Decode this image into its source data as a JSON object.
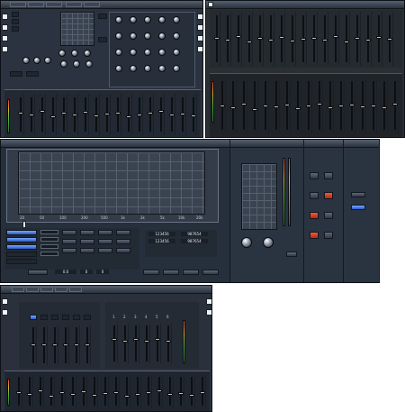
{
  "top_left": {
    "tabs": [
      "",
      "",
      "",
      "",
      ""
    ],
    "section_title": "",
    "eq_title": ""
  },
  "top_right": {
    "title": ""
  },
  "middle": {
    "title": "",
    "freq_ticks": [
      "20",
      "50",
      "100",
      "200",
      "500",
      "1k",
      "2k",
      "5k",
      "10k",
      "20k"
    ],
    "limiter_title": "",
    "output_title": "",
    "routing_title": "",
    "matrix_labels": [
      "1",
      "2",
      "3",
      "4",
      "5",
      "6"
    ],
    "counter_values": [
      "123456",
      "987654",
      "123456",
      "987654"
    ],
    "level_readouts": [
      "0.0",
      "0",
      "0"
    ],
    "routing_buttons": [
      "",
      ""
    ],
    "bottom_buttons": [
      "",
      "",
      "",
      "",
      ""
    ],
    "apply_button": ""
  },
  "bottom": {
    "tabs": [
      "",
      "",
      "",
      "",
      ""
    ],
    "title_left": "",
    "title_right": ""
  },
  "colors": {
    "panel": "#2b3340",
    "accent_red": "#d9361f",
    "accent_blue": "#2f6cf0"
  }
}
